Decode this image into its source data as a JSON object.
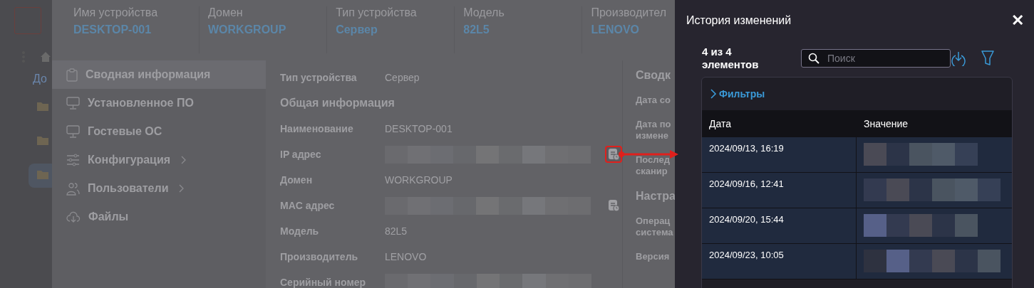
{
  "backdrop": {
    "breadcrumb": "До"
  },
  "header": [
    {
      "label": "Имя устройства",
      "value": "DESKTOP-001"
    },
    {
      "label": "Домен",
      "value": "WORKGROUP"
    },
    {
      "label": "Тип устройства",
      "value": "Сервер"
    },
    {
      "label": "Модель",
      "value": "82L5"
    },
    {
      "label": "Производител",
      "value": "LENOVO"
    }
  ],
  "sidebar": {
    "items": [
      {
        "label": "Сводная информация",
        "submenu": false,
        "selected": true
      },
      {
        "label": "Установленное ПО",
        "submenu": false,
        "selected": false
      },
      {
        "label": "Гостевые ОС",
        "submenu": false,
        "selected": false
      },
      {
        "label": "Конфигурация",
        "submenu": true,
        "selected": false
      },
      {
        "label": "Пользователи",
        "submenu": true,
        "selected": false
      },
      {
        "label": "Файлы",
        "submenu": false,
        "selected": false
      }
    ]
  },
  "details": [
    {
      "kind": "field",
      "label": "Тип устройства",
      "value": "Сервер"
    },
    {
      "kind": "section",
      "label": "Общая информация"
    },
    {
      "kind": "field",
      "label": "Наименование",
      "value": "DESKTOP-001"
    },
    {
      "kind": "redacted",
      "label": "IP адрес",
      "history": true,
      "highlighted": true
    },
    {
      "kind": "field",
      "label": "Домен",
      "value": "WORKGROUP"
    },
    {
      "kind": "redacted",
      "label": "MAC адрес",
      "history": true,
      "highlighted": false
    },
    {
      "kind": "field",
      "label": "Модель",
      "value": "82L5"
    },
    {
      "kind": "field",
      "label": "Производитель",
      "value": "LENOVO"
    },
    {
      "kind": "redacted",
      "label": "Серийный номер",
      "history": false
    }
  ],
  "summary": [
    {
      "kind": "section",
      "lines": [
        "Сводк"
      ]
    },
    {
      "kind": "field",
      "lines": [
        "Дата со"
      ]
    },
    {
      "kind": "field",
      "lines": [
        "Дата по",
        "измене"
      ]
    },
    {
      "kind": "field",
      "lines": [
        "Послед",
        "сканир"
      ]
    },
    {
      "kind": "section",
      "lines": [
        "Настра"
      ]
    },
    {
      "kind": "field",
      "lines": [
        "Операц",
        "система"
      ]
    },
    {
      "kind": "field",
      "lines": [
        "Версия"
      ]
    }
  ],
  "drawer": {
    "title": "История изменений",
    "close": "✕",
    "count": "4 из 4 элементов",
    "search": {
      "placeholder": "Поиск"
    },
    "filters": {
      "label": "Фильтры",
      "expanded": false
    },
    "table": {
      "columns": [
        "Дата",
        "Значение"
      ],
      "rows": [
        {
          "date": "2024/09/13, 16:19",
          "value": {
            "kind": "redacted"
          }
        },
        {
          "date": "2024/09/16, 12:41",
          "value": {
            "kind": "redacted"
          }
        },
        {
          "date": "2024/09/20, 15:44",
          "value": {
            "kind": "redacted"
          }
        },
        {
          "date": "2024/09/23, 10:05",
          "value": {
            "kind": "redacted"
          }
        }
      ]
    }
  }
}
